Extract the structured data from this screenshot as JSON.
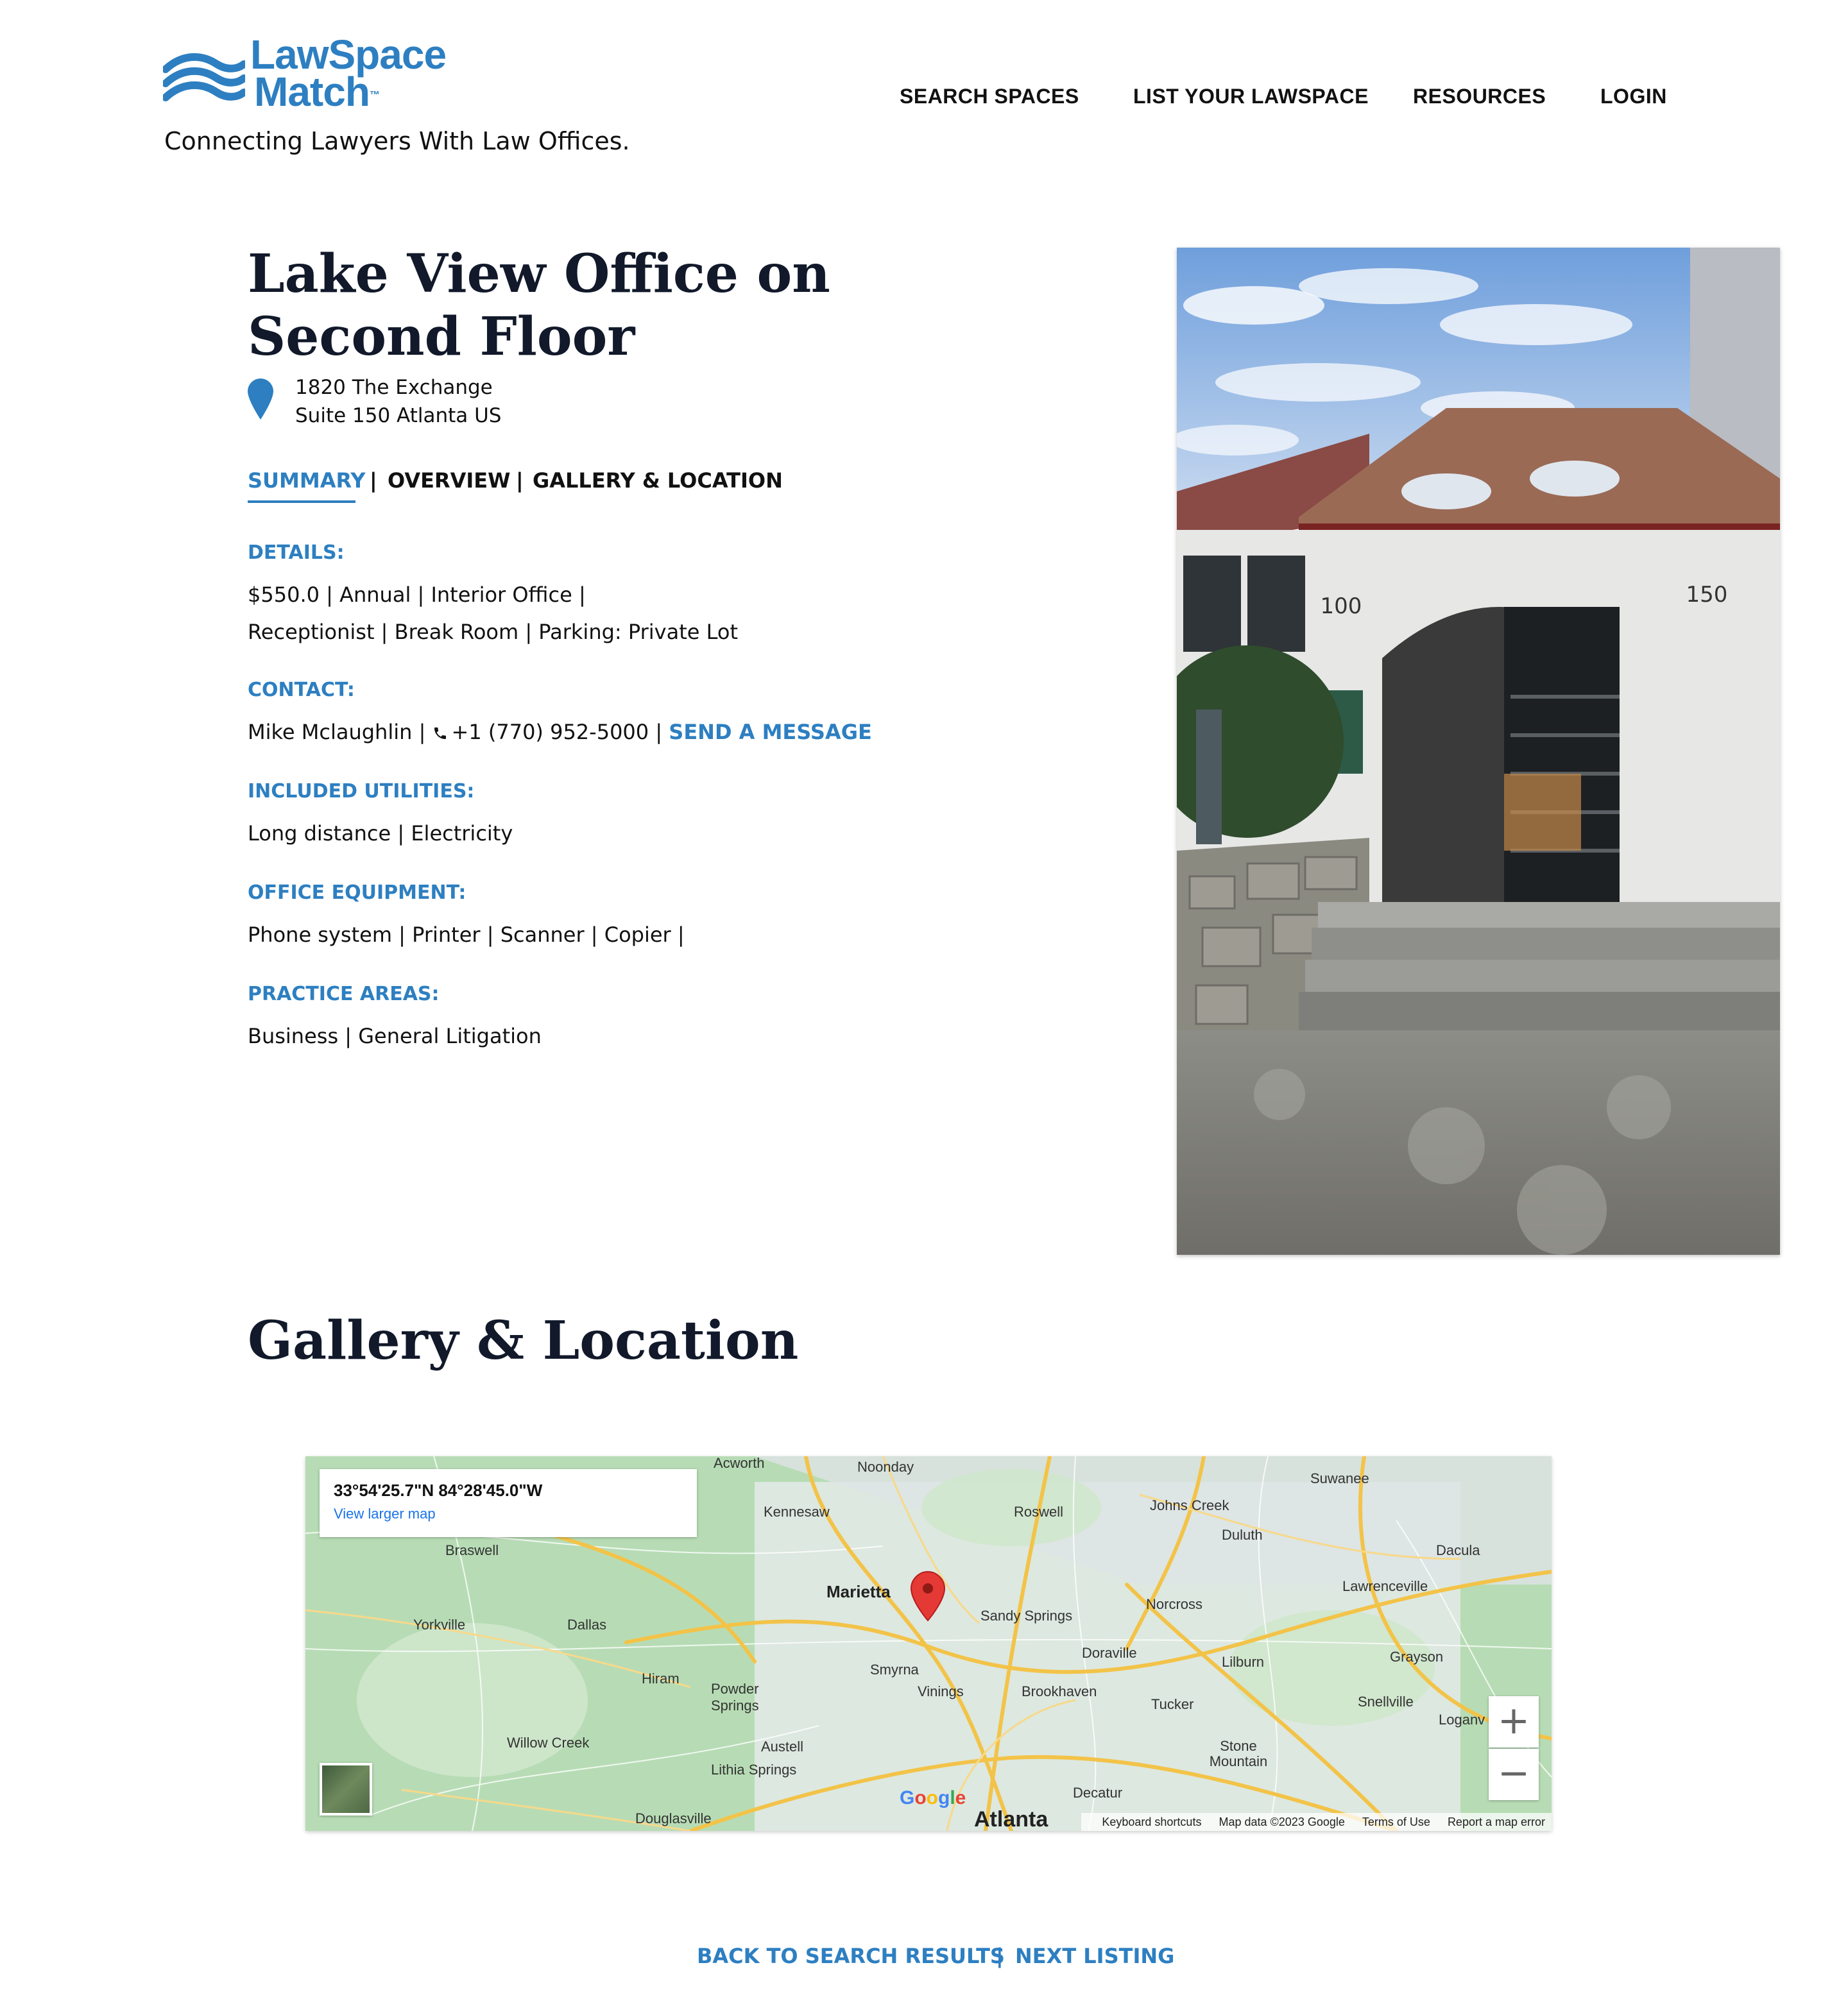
{
  "brand": {
    "logo_line1": "LawSpace",
    "logo_line2": "Match",
    "trademark": "™",
    "tagline": "Connecting Lawyers With Law Offices.",
    "color": "#2d7fc1"
  },
  "nav": {
    "items": [
      "SEARCH SPACES",
      "LIST YOUR LAWSPACE",
      "RESOURCES",
      "LOGIN"
    ]
  },
  "listing": {
    "title": "Lake View Office on Second Floor",
    "address_line1": "1820 The Exchange",
    "address_line2": "Suite 150 Atlanta US",
    "tabs": [
      "SUMMARY",
      "OVERVIEW",
      "GALLERY & LOCATION"
    ],
    "tab_separator": "|",
    "active_tab": "SUMMARY",
    "details_label": "DETAILS:",
    "details_line1": "$550.0  |  Annual  |  Interior Office  |",
    "details_line2": "Receptionist  |  Break Room  |  Parking: Private Lot",
    "contact_label": "CONTACT:",
    "contact_name": "Mike Mclaughlin  |",
    "contact_phone": "+1 (770) 952-5000  |",
    "send_message": "SEND A MESSAGE",
    "utilities_label": "INCLUDED UTILITIES:",
    "utilities": "Long distance  |  Electricity",
    "equipment_label": "OFFICE EQUIPMENT:",
    "equipment": "Phone system  |  Printer  |  Scanner  |  Copier  |",
    "practice_label": "PRACTICE AREAS:",
    "practice": "Business  |  General Litigation",
    "photo": {
      "unit_left": "100",
      "unit_right": "150"
    }
  },
  "gallery": {
    "title": "Gallery & Location",
    "map": {
      "coords": "33°54'25.7\"N 84°28'45.0\"W",
      "view_larger": "View larger map",
      "zoom_in": "+",
      "zoom_out": "−",
      "google": "Google",
      "atlanta": "Atlanta",
      "footer": [
        "Keyboard shortcuts",
        "Map data ©2023 Google",
        "Terms of Use",
        "Report a map error"
      ],
      "places": [
        "Acworth",
        "Noonday",
        "Suwanee",
        "Kennesaw",
        "Roswell",
        "Johns Creek",
        "Duluth",
        "Braswell",
        "Dacula",
        "Marietta",
        "Lawrenceville",
        "Sandy Springs",
        "Norcross",
        "Yorkville",
        "Dallas",
        "Doraville",
        "Lilburn",
        "Grayson",
        "Hiram",
        "Smyrna",
        "Powder Springs",
        "Vinings",
        "Brookhaven",
        "Tucker",
        "Snellville",
        "Loganv",
        "Willow Creek",
        "Austell",
        "Stone Mountain",
        "Lithia Springs",
        "Decatur",
        "Douglasville"
      ]
    }
  },
  "footer_links": {
    "back": "BACK TO SEARCH RESULTS",
    "separator": "|",
    "next": "NEXT LISTING"
  }
}
